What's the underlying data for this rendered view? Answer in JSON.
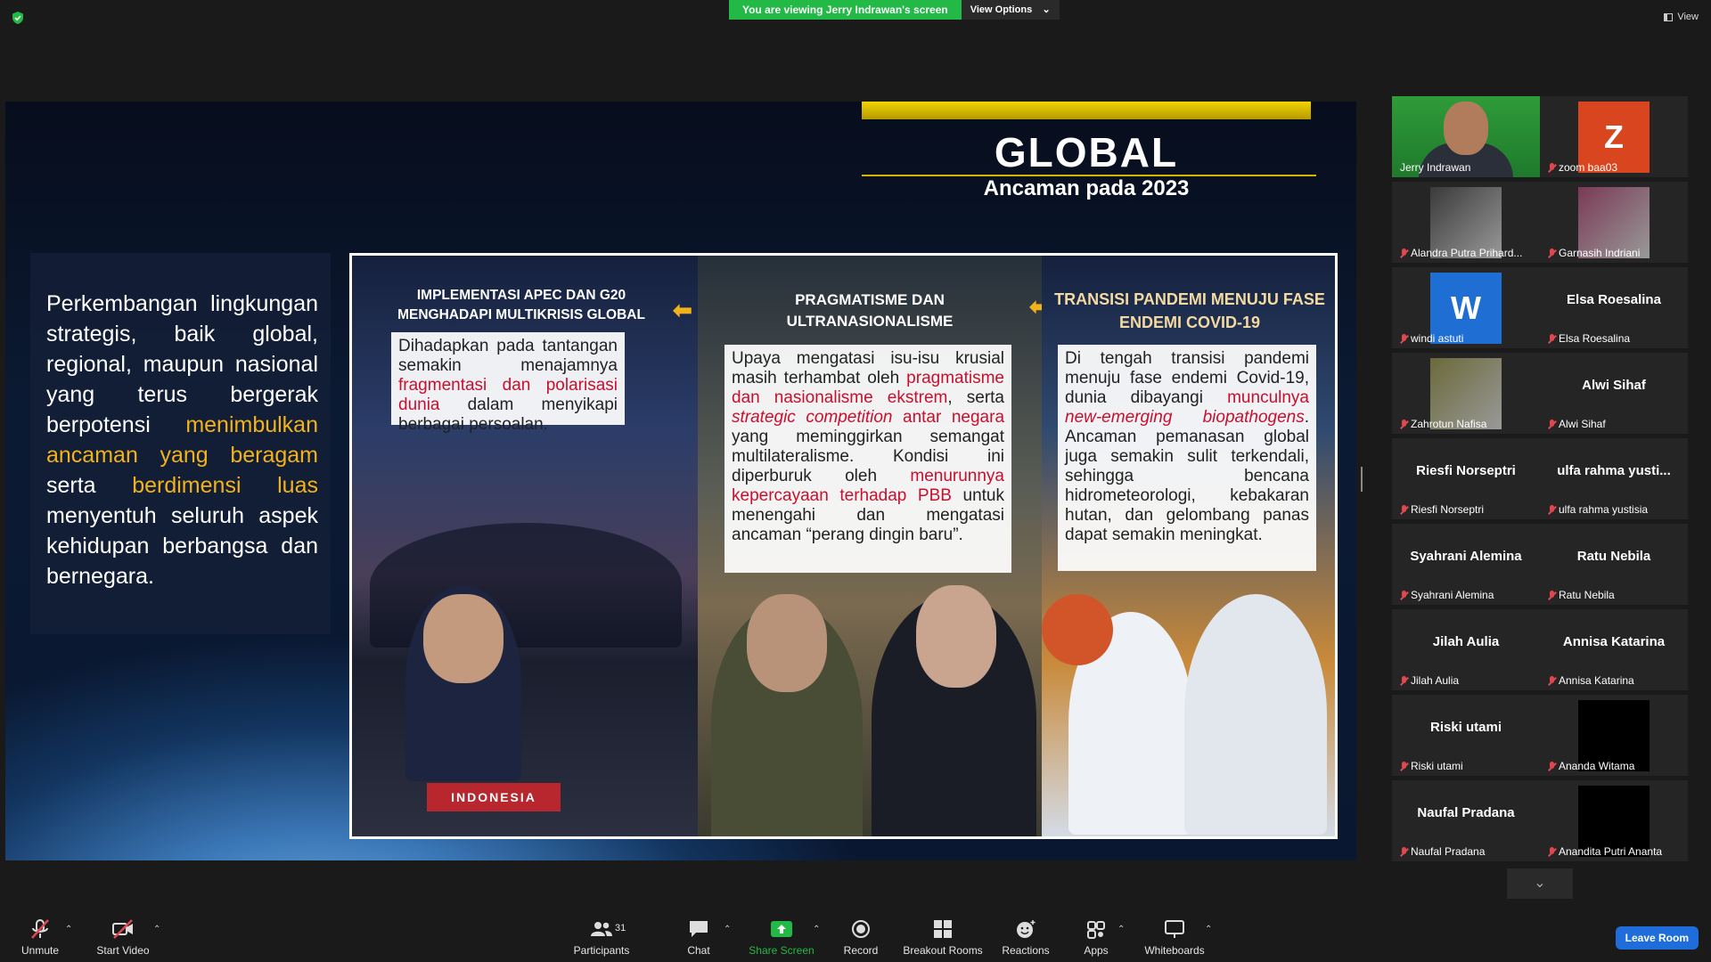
{
  "topbar": {
    "share_banner": "You are viewing Jerry Indrawan's screen",
    "view_options": "View Options",
    "view_button": "View"
  },
  "slide": {
    "title": "GLOBAL",
    "subtitle": "Ancaman pada 2023",
    "left_text_parts": {
      "p1": "Perkembangan lingkungan strategis, baik global, regional, maupun nasional yang terus bergerak berpotensi ",
      "hl1": "menimbulkan ancaman yang beragam",
      "p2": " serta ",
      "hl2": "berdimensi luas",
      "p3": " menyentuh seluruh aspek kehidupan berbangsa dan bernegara."
    },
    "panels": [
      {
        "heading": "IMPLEMENTASI APEC DAN G20 MENGHADAPI MULTIKRISIS GLOBAL",
        "t1": "Dihadapkan pada tantangan semakin menajamnya ",
        "r1": "fragmentasi dan polarisasi dunia",
        "t2": " dalam menyikapi berbagai persoalan.",
        "nameplate": "INDONESIA"
      },
      {
        "heading": "PRAGMATISME DAN ULTRANASIONALISME",
        "t1": "Upaya mengatasi isu-isu krusial masih terhambat oleh ",
        "r1": "pragmatisme dan nasionalisme ekstrem",
        "t2": ", serta ",
        "ri1": "strategic competition",
        "r2": " antar negara",
        "t3": " yang meminggirkan semangat multilateralisme. Kondisi ini diperburuk oleh ",
        "r3": "menurunnya kepercayaan terhadap PBB",
        "t4": " untuk menengahi dan mengatasi ancaman “perang dingin baru”."
      },
      {
        "heading": "TRANSISI PANDEMI MENUJU FASE ENDEMI COVID-19",
        "t1": "Di tengah transisi pandemi menuju fase endemi Covid-19, dunia dibayangi ",
        "r1": "munculnya ",
        "ri1": "new-emerging biopathogens",
        "t2": ". Ancaman pemanasan global juga semakin sulit terkendali, sehingga bencana hidrometeorologi, kebakaran hutan, dan gelombang panas dapat semakin meningkat."
      }
    ]
  },
  "participants": [
    {
      "name": "Jerry Indrawan",
      "type": "video",
      "active": true
    },
    {
      "name": "zoom baa03",
      "type": "letter",
      "letter": "Z",
      "color": "#d8451f"
    },
    {
      "name": "Alandra Putra Prihard...",
      "type": "photo"
    },
    {
      "name": "Garnasih Indriani",
      "type": "photo"
    },
    {
      "name": "windi astuti",
      "type": "letter",
      "letter": "W",
      "color": "#1f6ed4"
    },
    {
      "name": "Elsa Roesalina",
      "type": "text",
      "big": "Elsa Roesalina"
    },
    {
      "name": "Zahrotun Nafisa",
      "type": "photo"
    },
    {
      "name": "Alwi Sihaf",
      "type": "text",
      "big": "Alwi Sihaf"
    },
    {
      "name": "Riesfi Norseptri",
      "type": "text",
      "big": "Riesfi Norseptri"
    },
    {
      "name": "ulfa rahma yustisia",
      "type": "text",
      "big": "ulfa rahma yusti..."
    },
    {
      "name": "Syahrani Alemina",
      "type": "text",
      "big": "Syahrani Alemina"
    },
    {
      "name": "Ratu Nebila",
      "type": "text",
      "big": "Ratu Nebila"
    },
    {
      "name": "Jilah Aulia",
      "type": "text",
      "big": "Jilah Aulia"
    },
    {
      "name": "Annisa Katarina",
      "type": "text",
      "big": "Annisa Katarina"
    },
    {
      "name": "Riski utami",
      "type": "text",
      "big": "Riski utami"
    },
    {
      "name": "Ananda Witama",
      "type": "black"
    },
    {
      "name": "Naufal Pradana",
      "type": "text",
      "big": "Naufal Pradana"
    },
    {
      "name": "Anandita Putri Ananta",
      "type": "black"
    }
  ],
  "toolbar": {
    "unmute": "Unmute",
    "start_video": "Start Video",
    "participants": "Participants",
    "participants_count": "31",
    "chat": "Chat",
    "share_screen": "Share Screen",
    "record": "Record",
    "breakout_rooms": "Breakout Rooms",
    "reactions": "Reactions",
    "apps": "Apps",
    "whiteboards": "Whiteboards",
    "leave_room": "Leave Room"
  },
  "colors": {
    "share_green": "#23b946",
    "highlight_yellow": "#f2b21c",
    "text_red": "#c8102e",
    "leave_blue": "#1f6ddb",
    "active_speaker": "#9ee44a"
  }
}
